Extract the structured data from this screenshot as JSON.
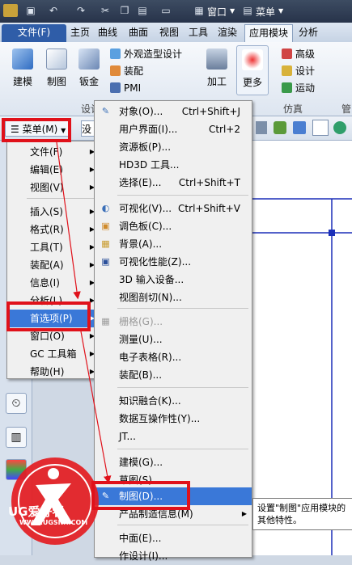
{
  "titlebar": {
    "window": "窗口",
    "menu": "菜单"
  },
  "tabs": [
    "文件(F)",
    "主页",
    "曲线",
    "曲面",
    "视图",
    "工具",
    "渲染",
    "应用模块",
    "分析"
  ],
  "ribbon": {
    "big": [
      "建模",
      "制图",
      "钣金",
      "加工",
      "更多"
    ],
    "small_left": [
      "外观造型设计",
      "装配",
      "PMI"
    ],
    "small_right": [
      "高级",
      "设计",
      "运动"
    ],
    "groups": [
      "设计",
      "仿真",
      "管"
    ]
  },
  "toolbar2": {
    "menu_button": "菜单(M)",
    "combo": "没"
  },
  "left_menu": {
    "items": [
      {
        "label": "文件(F)",
        "arrow": true
      },
      {
        "label": "编辑(E)",
        "arrow": true
      },
      {
        "label": "视图(V)",
        "arrow": true
      },
      {
        "label": "插入(S)",
        "arrow": true
      },
      {
        "label": "格式(R)",
        "arrow": true
      },
      {
        "label": "工具(T)",
        "arrow": true
      },
      {
        "label": "装配(A)",
        "arrow": true
      },
      {
        "label": "信息(I)",
        "arrow": true
      },
      {
        "label": "分析(L)",
        "arrow": true
      },
      {
        "label": "首选项(P)",
        "arrow": true
      },
      {
        "label": "窗口(O)",
        "arrow": true
      },
      {
        "label": "GC 工具箱",
        "arrow": true
      },
      {
        "label": "帮助(H)",
        "arrow": true
      }
    ]
  },
  "sub_menu": {
    "items": [
      {
        "label": "对象(O)...",
        "shortcut": "Ctrl+Shift+J"
      },
      {
        "label": "用户界面(I)...",
        "shortcut": "Ctrl+2"
      },
      {
        "label": "资源板(P)...",
        "shortcut": ""
      },
      {
        "label": "HD3D 工具...",
        "shortcut": ""
      },
      {
        "label": "选择(E)...",
        "shortcut": "Ctrl+Shift+T"
      },
      {
        "label": "可视化(V)...",
        "shortcut": "Ctrl+Shift+V"
      },
      {
        "label": "调色板(C)...",
        "shortcut": ""
      },
      {
        "label": "背景(A)...",
        "shortcut": ""
      },
      {
        "label": "可视化性能(Z)...",
        "shortcut": ""
      },
      {
        "label": "3D 输入设备...",
        "shortcut": ""
      },
      {
        "label": "视图剖切(N)...",
        "shortcut": ""
      },
      {
        "label": "栅格(G)...",
        "shortcut": ""
      },
      {
        "label": "测量(U)...",
        "shortcut": ""
      },
      {
        "label": "电子表格(R)...",
        "shortcut": ""
      },
      {
        "label": "装配(B)...",
        "shortcut": ""
      },
      {
        "label": "知识融合(K)...",
        "shortcut": ""
      },
      {
        "label": "数据互操作性(Y)...",
        "shortcut": ""
      },
      {
        "label": "JT...",
        "shortcut": ""
      },
      {
        "label": "建模(G)...",
        "shortcut": ""
      },
      {
        "label": "草图(S)...",
        "shortcut": ""
      },
      {
        "label": "制图(D)...",
        "shortcut": ""
      },
      {
        "label": "产品制造信息(M)",
        "shortcut": ""
      },
      {
        "label": "中面(E)...",
        "shortcut": ""
      },
      {
        "label": "作设计(I)...",
        "shortcut": ""
      }
    ]
  },
  "tooltip": {
    "text": "设置\"制图\"应用模块的其他特性。"
  },
  "watermark": {
    "brand": "UG爱好者",
    "url": "WWW.UGSNX.COM"
  },
  "colors": {
    "highlight": "#3a78d8",
    "annotation": "#e0111a",
    "file_tab": "#2f5da8"
  }
}
